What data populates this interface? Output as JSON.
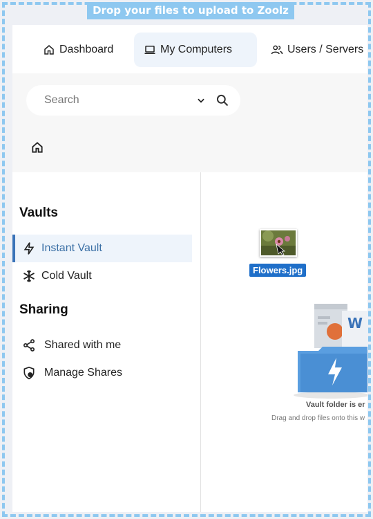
{
  "drop_banner": "Drop your files to upload to Zoolz",
  "nav": {
    "tabs": [
      {
        "label": "Dashboard",
        "icon": "home-icon"
      },
      {
        "label": "My Computers",
        "icon": "laptop-icon",
        "active": true
      },
      {
        "label": "Users / Servers",
        "icon": "users-icon"
      }
    ]
  },
  "search": {
    "placeholder": "Search",
    "value": ""
  },
  "sidebar": {
    "vaults_title": "Vaults",
    "vaults": [
      {
        "label": "Instant Vault",
        "icon": "lightning-icon",
        "active": true
      },
      {
        "label": "Cold Vault",
        "icon": "snowflake-icon"
      }
    ],
    "sharing_title": "Sharing",
    "sharing": [
      {
        "label": "Shared with me",
        "icon": "share-icon"
      },
      {
        "label": "Manage Shares",
        "icon": "shield-icon"
      }
    ]
  },
  "main": {
    "dragged_file": "Flowers.jpg",
    "empty_title": "Vault folder is er",
    "empty_subtitle": "Drag and drop files onto this w"
  },
  "colors": {
    "accent": "#3a73b8",
    "active_bg": "#eef4fb",
    "drop_border": "#8ec8f0",
    "folder": "#4a8fd4"
  }
}
